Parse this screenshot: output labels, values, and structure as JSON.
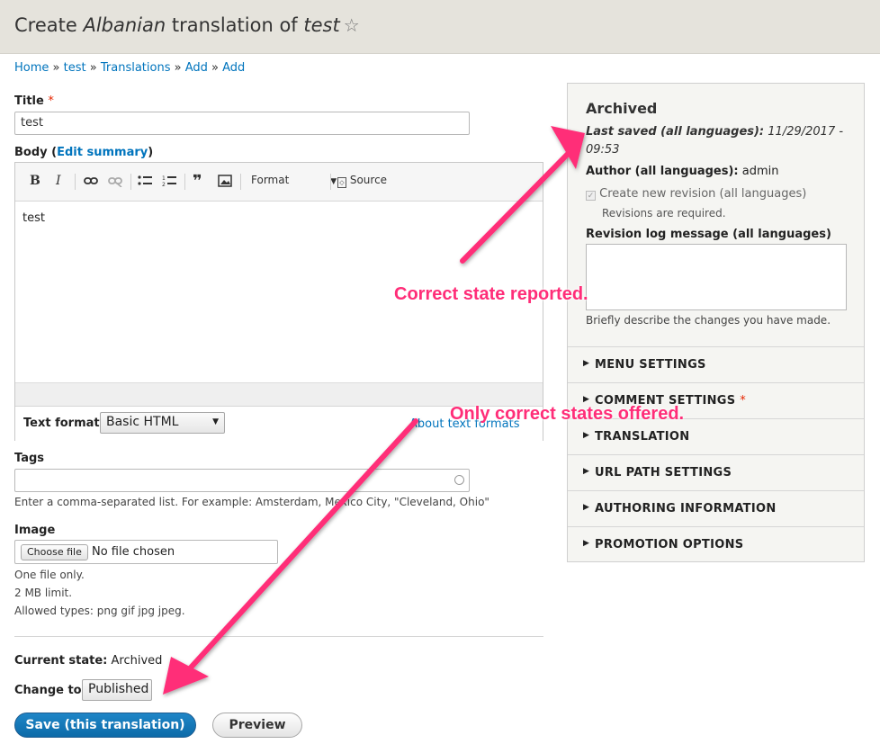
{
  "header": {
    "title_prefix": "Create ",
    "title_language": "Albanian",
    "title_middle": " translation of ",
    "title_node": "test",
    "star_icon": "star-icon"
  },
  "breadcrumb": [
    "Home",
    "test",
    "Translations",
    "Add",
    "Add"
  ],
  "breadcrumb_sep": "»",
  "form": {
    "title_label": "Title",
    "title_value": "test",
    "body_label": "Body",
    "edit_summary_link": "Edit summary",
    "toolbar": {
      "bold": "B",
      "italic": "I",
      "format_label": "Format",
      "source_label": "Source"
    },
    "body_text": "test",
    "text_format_label": "Text format",
    "text_format_value": "Basic HTML",
    "about_formats_link": "About text formats",
    "tags_label": "Tags",
    "tags_value": "",
    "tags_description": "Enter a comma-separated list. For example: Amsterdam, Mexico City, \"Cleveland, Ohio\"",
    "image_label": "Image",
    "choose_file_label": "Choose file",
    "no_file_text": "No file chosen",
    "image_help": [
      "One file only.",
      "2 MB limit.",
      "Allowed types: png gif jpg jpeg."
    ],
    "current_state_label": "Current state:",
    "current_state_value": "Archived",
    "change_to_label": "Change to:",
    "change_to_value": "Published",
    "save_button": "Save (this translation)",
    "preview_button": "Preview"
  },
  "sidebar": {
    "status_heading": "Archived",
    "last_saved_label": "Last saved (all languages):",
    "last_saved_value": "11/29/2017 - 09:53",
    "author_label": "Author (all languages):",
    "author_value": "admin",
    "new_revision_label": "Create new revision (all languages)",
    "new_revision_checked": true,
    "revisions_required": "Revisions are required.",
    "revision_log_label": "Revision log message (all languages)",
    "revision_log_value": "",
    "revision_log_help": "Briefly describe the changes you have made.",
    "sections": [
      "MENU SETTINGS",
      "COMMENT SETTINGS",
      "TRANSLATION",
      "URL PATH SETTINGS",
      "AUTHORING INFORMATION",
      "PROMOTION OPTIONS"
    ]
  },
  "annotations": {
    "top": "Correct state reported.",
    "bottom": "Only correct states offered."
  },
  "colors": {
    "annotation": "#ff2d78",
    "link": "#0074bd",
    "primary_button": "#1479bc",
    "header_bg": "#e5e3dc"
  }
}
